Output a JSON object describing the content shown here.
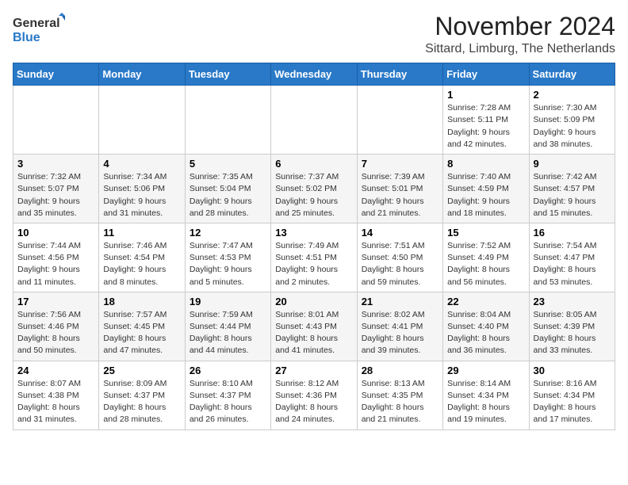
{
  "header": {
    "logo": {
      "general": "General",
      "blue": "Blue"
    },
    "month": "November 2024",
    "location": "Sittard, Limburg, The Netherlands"
  },
  "calendar": {
    "weekdays": [
      "Sunday",
      "Monday",
      "Tuesday",
      "Wednesday",
      "Thursday",
      "Friday",
      "Saturday"
    ],
    "weeks": [
      [
        {
          "day": "",
          "info": ""
        },
        {
          "day": "",
          "info": ""
        },
        {
          "day": "",
          "info": ""
        },
        {
          "day": "",
          "info": ""
        },
        {
          "day": "",
          "info": ""
        },
        {
          "day": "1",
          "info": "Sunrise: 7:28 AM\nSunset: 5:11 PM\nDaylight: 9 hours and 42 minutes."
        },
        {
          "day": "2",
          "info": "Sunrise: 7:30 AM\nSunset: 5:09 PM\nDaylight: 9 hours and 38 minutes."
        }
      ],
      [
        {
          "day": "3",
          "info": "Sunrise: 7:32 AM\nSunset: 5:07 PM\nDaylight: 9 hours and 35 minutes."
        },
        {
          "day": "4",
          "info": "Sunrise: 7:34 AM\nSunset: 5:06 PM\nDaylight: 9 hours and 31 minutes."
        },
        {
          "day": "5",
          "info": "Sunrise: 7:35 AM\nSunset: 5:04 PM\nDaylight: 9 hours and 28 minutes."
        },
        {
          "day": "6",
          "info": "Sunrise: 7:37 AM\nSunset: 5:02 PM\nDaylight: 9 hours and 25 minutes."
        },
        {
          "day": "7",
          "info": "Sunrise: 7:39 AM\nSunset: 5:01 PM\nDaylight: 9 hours and 21 minutes."
        },
        {
          "day": "8",
          "info": "Sunrise: 7:40 AM\nSunset: 4:59 PM\nDaylight: 9 hours and 18 minutes."
        },
        {
          "day": "9",
          "info": "Sunrise: 7:42 AM\nSunset: 4:57 PM\nDaylight: 9 hours and 15 minutes."
        }
      ],
      [
        {
          "day": "10",
          "info": "Sunrise: 7:44 AM\nSunset: 4:56 PM\nDaylight: 9 hours and 11 minutes."
        },
        {
          "day": "11",
          "info": "Sunrise: 7:46 AM\nSunset: 4:54 PM\nDaylight: 9 hours and 8 minutes."
        },
        {
          "day": "12",
          "info": "Sunrise: 7:47 AM\nSunset: 4:53 PM\nDaylight: 9 hours and 5 minutes."
        },
        {
          "day": "13",
          "info": "Sunrise: 7:49 AM\nSunset: 4:51 PM\nDaylight: 9 hours and 2 minutes."
        },
        {
          "day": "14",
          "info": "Sunrise: 7:51 AM\nSunset: 4:50 PM\nDaylight: 8 hours and 59 minutes."
        },
        {
          "day": "15",
          "info": "Sunrise: 7:52 AM\nSunset: 4:49 PM\nDaylight: 8 hours and 56 minutes."
        },
        {
          "day": "16",
          "info": "Sunrise: 7:54 AM\nSunset: 4:47 PM\nDaylight: 8 hours and 53 minutes."
        }
      ],
      [
        {
          "day": "17",
          "info": "Sunrise: 7:56 AM\nSunset: 4:46 PM\nDaylight: 8 hours and 50 minutes."
        },
        {
          "day": "18",
          "info": "Sunrise: 7:57 AM\nSunset: 4:45 PM\nDaylight: 8 hours and 47 minutes."
        },
        {
          "day": "19",
          "info": "Sunrise: 7:59 AM\nSunset: 4:44 PM\nDaylight: 8 hours and 44 minutes."
        },
        {
          "day": "20",
          "info": "Sunrise: 8:01 AM\nSunset: 4:43 PM\nDaylight: 8 hours and 41 minutes."
        },
        {
          "day": "21",
          "info": "Sunrise: 8:02 AM\nSunset: 4:41 PM\nDaylight: 8 hours and 39 minutes."
        },
        {
          "day": "22",
          "info": "Sunrise: 8:04 AM\nSunset: 4:40 PM\nDaylight: 8 hours and 36 minutes."
        },
        {
          "day": "23",
          "info": "Sunrise: 8:05 AM\nSunset: 4:39 PM\nDaylight: 8 hours and 33 minutes."
        }
      ],
      [
        {
          "day": "24",
          "info": "Sunrise: 8:07 AM\nSunset: 4:38 PM\nDaylight: 8 hours and 31 minutes."
        },
        {
          "day": "25",
          "info": "Sunrise: 8:09 AM\nSunset: 4:37 PM\nDaylight: 8 hours and 28 minutes."
        },
        {
          "day": "26",
          "info": "Sunrise: 8:10 AM\nSunset: 4:37 PM\nDaylight: 8 hours and 26 minutes."
        },
        {
          "day": "27",
          "info": "Sunrise: 8:12 AM\nSunset: 4:36 PM\nDaylight: 8 hours and 24 minutes."
        },
        {
          "day": "28",
          "info": "Sunrise: 8:13 AM\nSunset: 4:35 PM\nDaylight: 8 hours and 21 minutes."
        },
        {
          "day": "29",
          "info": "Sunrise: 8:14 AM\nSunset: 4:34 PM\nDaylight: 8 hours and 19 minutes."
        },
        {
          "day": "30",
          "info": "Sunrise: 8:16 AM\nSunset: 4:34 PM\nDaylight: 8 hours and 17 minutes."
        }
      ]
    ]
  }
}
